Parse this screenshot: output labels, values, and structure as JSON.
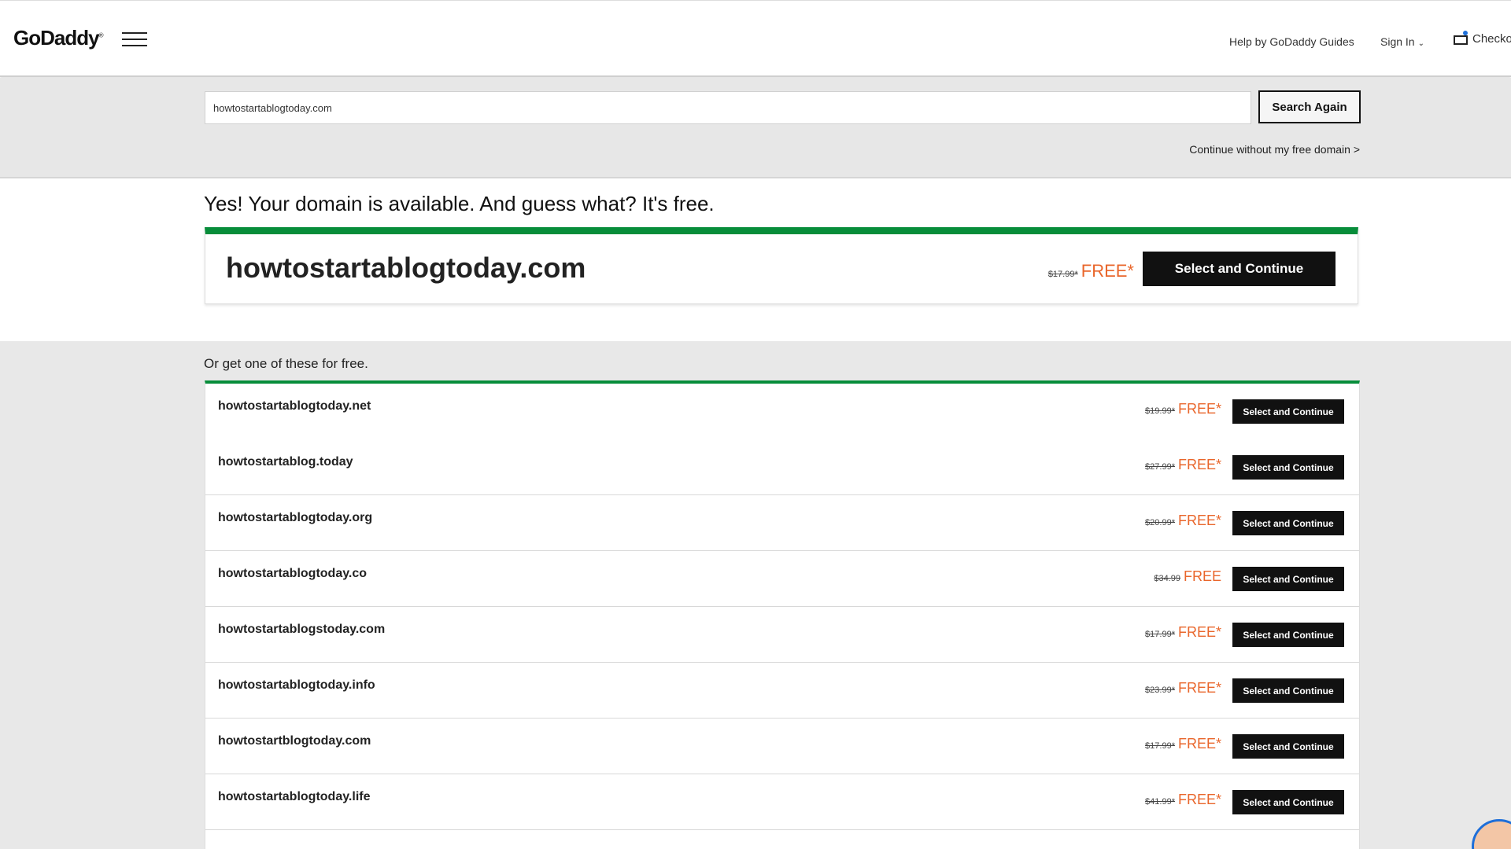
{
  "header": {
    "logo": "GoDaddy",
    "logo_mark": "®",
    "help_link": "Help by GoDaddy Guides",
    "sign_in": "Sign In",
    "checkout": "Checko"
  },
  "search": {
    "value": "howtostartablogtoday.com",
    "button": "Search Again",
    "continue_link": "Continue without my free domain >"
  },
  "available": {
    "title": "Yes! Your domain is available. And guess what? It's free.",
    "domain": "howtostartablogtoday.com",
    "old_price": "$17.99*",
    "free": "FREE*",
    "button": "Select and Continue"
  },
  "alternatives": {
    "title": "Or get one of these for free.",
    "items": [
      {
        "domain": "howtostartablogtoday.net",
        "old_price": "$19.99*",
        "free": "FREE*",
        "button": "Select and Continue"
      },
      {
        "domain": "howtostartablog.today",
        "old_price": "$27.99*",
        "free": "FREE*",
        "button": "Select and Continue"
      },
      {
        "domain": "howtostartablogtoday.org",
        "old_price": "$20.99*",
        "free": "FREE*",
        "button": "Select and Continue"
      },
      {
        "domain": "howtostartablogtoday.co",
        "old_price": "$34.99",
        "free": "FREE",
        "button": "Select and Continue"
      },
      {
        "domain": "howtostartablogstoday.com",
        "old_price": "$17.99*",
        "free": "FREE*",
        "button": "Select and Continue"
      },
      {
        "domain": "howtostartablogtoday.info",
        "old_price": "$23.99*",
        "free": "FREE*",
        "button": "Select and Continue"
      },
      {
        "domain": "howtostartblogtoday.com",
        "old_price": "$17.99*",
        "free": "FREE*",
        "button": "Select and Continue"
      },
      {
        "domain": "howtostartablogtoday.life",
        "old_price": "$41.99*",
        "free": "FREE*",
        "button": "Select and Continue"
      }
    ]
  },
  "colors": {
    "accent_green": "#078d3a",
    "free_orange": "#e9662b",
    "button_black": "#111111"
  }
}
